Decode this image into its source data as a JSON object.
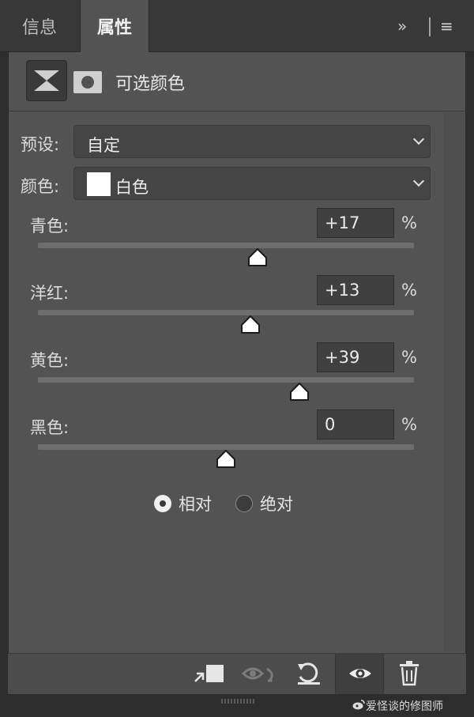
{
  "tabs": [
    {
      "label": "信息"
    },
    {
      "label": "属性"
    }
  ],
  "tab_controls": {
    "collapse_glyph": "»",
    "menu_glyph": "≡"
  },
  "header": {
    "title": "可选颜色"
  },
  "preset": {
    "label": "预设:",
    "value": "自定"
  },
  "color": {
    "label": "颜色:",
    "value": "白色",
    "swatch": "#ffffff"
  },
  "sliders": [
    {
      "label": "青色:",
      "value": "+17",
      "unit": "%",
      "level": 17
    },
    {
      "label": "洋红:",
      "value": "+13",
      "unit": "%",
      "level": 13
    },
    {
      "label": "黄色:",
      "value": "+39",
      "unit": "%",
      "level": 39
    },
    {
      "label": "黑色:",
      "value": "0",
      "unit": "%",
      "level": 0
    }
  ],
  "method": {
    "options": [
      {
        "label": "相对",
        "selected": true
      },
      {
        "label": "绝对",
        "selected": false
      }
    ]
  },
  "footer_icons": [
    "clip-to-layer-icon",
    "view-previous-icon",
    "reset-icon",
    "visibility-eye-icon",
    "trash-icon"
  ],
  "watermark": {
    "text": "爱怪谈的修图师"
  }
}
